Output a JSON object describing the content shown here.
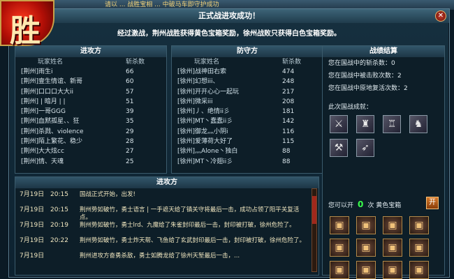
{
  "background_text": "请以 ... 战胜宝相 ... 中破马车即守护成功",
  "badge": {
    "char": "胜"
  },
  "dialog": {
    "title": "正式战进攻成功！",
    "announcement": "经过激战，荆州战胜获得黄色宝箱奖励，徐州战败只获得白色宝箱奖励。",
    "close_label": "✕"
  },
  "attack": {
    "header": "进攻方",
    "col_name": "玩家姓名",
    "col_kills": "斩杀数",
    "rows": [
      {
        "name": "[荆州]雨生i",
        "kills": "66"
      },
      {
        "name": "[荆州]壹生情谊、新哥",
        "kills": "60"
      },
      {
        "name": "[荆州]口口口大大ii",
        "kills": "57"
      },
      {
        "name": "[荆州] | 暗月 | |",
        "kills": "51"
      },
      {
        "name": "[荆州]一哥GGG",
        "kills": "39"
      },
      {
        "name": "[荆州]血黙孤星、、狂",
        "kills": "35"
      },
      {
        "name": "[荆州]杀戮、violence",
        "kills": "29"
      },
      {
        "name": "[荆州]陌上繁花、稳少",
        "kills": "28"
      },
      {
        "name": "[荆州]大大炫cc",
        "kills": "27"
      },
      {
        "name": "[荆州]情、天魂",
        "kills": "25"
      }
    ]
  },
  "defend": {
    "header": "防守方",
    "col_name": "玩家姓名",
    "col_kills": "斩杀数",
    "rows": [
      {
        "name": "[徐州]战神田右索",
        "kills": "474"
      },
      {
        "name": "[徐州]幻想iii、",
        "kills": "248"
      },
      {
        "name": "[徐州]开开心心一起玩",
        "kills": "217"
      },
      {
        "name": "[徐州]微采iii",
        "kills": "208"
      },
      {
        "name": "[徐州]丿、绝情ii彡",
        "kills": "181"
      },
      {
        "name": "[徐州]MT丶蠢蠢ii彡",
        "kills": "142"
      },
      {
        "name": "[徐州]御龙灬小阴i",
        "kills": "116"
      },
      {
        "name": "[徐州]爱薄荷大好了",
        "kills": "115"
      },
      {
        "name": "[徐州]灬Alone丶独白",
        "kills": "88"
      },
      {
        "name": "[徐州]MT丶冷翅ii彡",
        "kills": "88"
      }
    ]
  },
  "summary": {
    "header": "战绩结算",
    "kills_label": "您在国战中的斩杀数：0",
    "defeats_label": "您在国战中被击败次数：2",
    "revives_label": "您在国战中原地复活次数：2",
    "honor_label": "此次国战成就：",
    "honor_icons": [
      "sword-icon",
      "warrior-icon",
      "armor-icon",
      "beast-icon",
      "blade-icon",
      "arrow-icon"
    ],
    "reward_prefix": "您可以开",
    "reward_count": "0",
    "reward_suffix": "次 黄色宝箱",
    "reward_button": "开",
    "chest_count": 12
  },
  "log": {
    "header": "进攻方",
    "entries": [
      {
        "date": "7月19日",
        "time": "20:15",
        "msg": "国战正式开始，出发!"
      },
      {
        "date": "7月19日",
        "time": "20:15",
        "msg": "荆州势如破竹，勇士语言 | 一手遮天给了镇关守将最后一击，成功占领了阳平关复活点。"
      },
      {
        "date": "7月19日",
        "time": "20:19",
        "msg": "荆州势如破竹，勇士lrd、九魔给了朱雀封印最后一击，封印被打破，徐州危险了。"
      },
      {
        "date": "7月19日",
        "time": "20:22",
        "msg": "荆州势如破竹，勇士炸天帮、飞鱼给了玄武封印最后一击，封印被打破，徐州危险了。"
      },
      {
        "date": "7月19日",
        "time": "",
        "msg": "荆州进攻方奋勇杀敌，勇士如腾龙给了徐州天堑最后一击，..."
      }
    ]
  }
}
